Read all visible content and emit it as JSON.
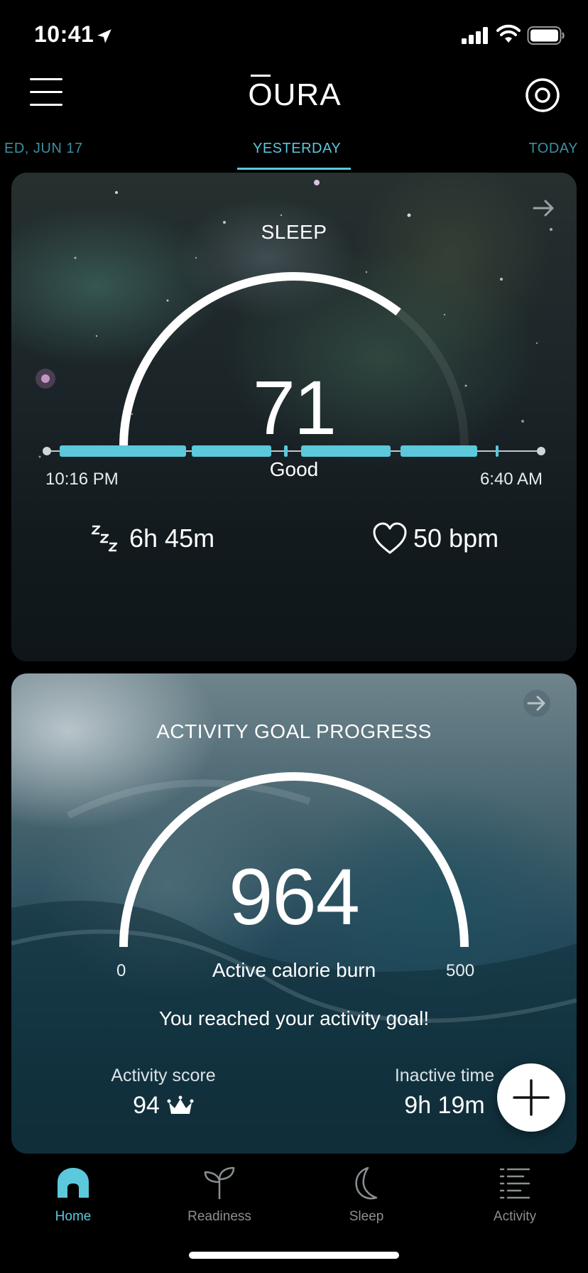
{
  "status_bar": {
    "time": "10:41"
  },
  "header": {
    "logo_text": "URA",
    "logo_o": "O"
  },
  "day_tabs": {
    "prev": "ED, JUN 17",
    "current": "YESTERDAY",
    "next": "TODAY"
  },
  "sleep_card": {
    "title": "SLEEP",
    "score": "71",
    "score_fraction": 0.71,
    "rating": "Good",
    "bedtime_start": "10:16 PM",
    "bedtime_end": "6:40 AM",
    "total_sleep": "6h 45m",
    "heart_rate": "50 bpm"
  },
  "activity_card": {
    "title": "ACTIVITY GOAL PROGRESS",
    "calories": "964",
    "calories_label": "Active calorie burn",
    "range_min": "0",
    "range_max": "500",
    "goal_message": "You reached your activity goal!",
    "activity_score_label": "Activity score",
    "activity_score": "94",
    "inactive_time_label": "Inactive time",
    "inactive_time": "9h 19m"
  },
  "bottom_nav": {
    "items": [
      {
        "label": "Home",
        "icon": "home-icon",
        "active": true
      },
      {
        "label": "Readiness",
        "icon": "sprout-icon",
        "active": false
      },
      {
        "label": "Sleep",
        "icon": "moon-icon",
        "active": false
      },
      {
        "label": "Activity",
        "icon": "activity-list-icon",
        "active": false
      }
    ]
  },
  "colors": {
    "accent": "#5bc8dc",
    "inactive_nav": "#8a8f92",
    "background": "#000000"
  }
}
